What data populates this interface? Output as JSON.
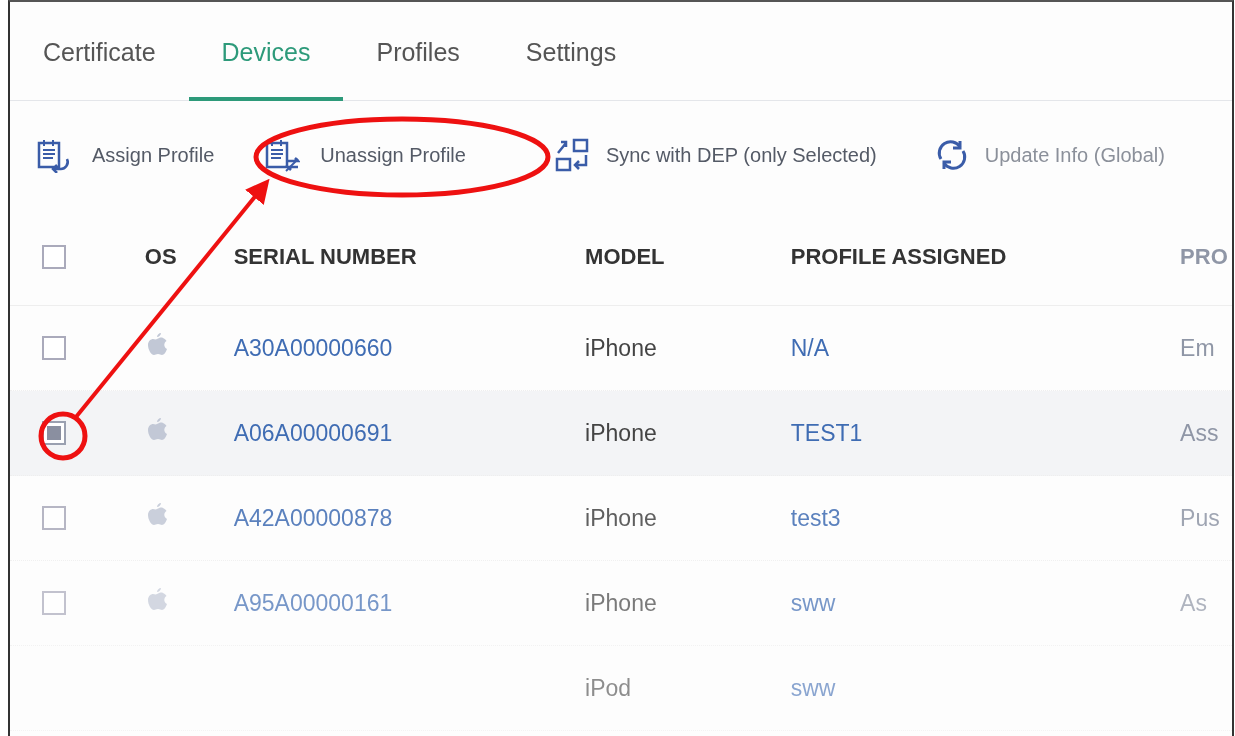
{
  "tabs": [
    {
      "label": "Certificate",
      "selected": false
    },
    {
      "label": "Devices",
      "selected": true
    },
    {
      "label": "Profiles",
      "selected": false
    },
    {
      "label": "Settings",
      "selected": false
    }
  ],
  "toolbar": [
    {
      "kind": "assign",
      "label": "Assign Profile"
    },
    {
      "kind": "unassign",
      "label": "Unassign Profile"
    },
    {
      "kind": "sync",
      "label": "Sync with DEP (only Selected)"
    },
    {
      "kind": "update",
      "label": "Update Info (Global)"
    }
  ],
  "table": {
    "select_all_checked": false,
    "columns": [
      "OS",
      "SERIAL NUMBER",
      "MODEL",
      "PROFILE ASSIGNED",
      "PRO"
    ],
    "rows": [
      {
        "checked": false,
        "serial": "A30A00000660",
        "model": "iPhone",
        "profile": "N/A",
        "column_6": "Em"
      },
      {
        "checked": true,
        "serial": "A06A00000691",
        "model": "iPhone",
        "profile": "TEST1",
        "column_6": "Ass"
      },
      {
        "checked": false,
        "serial": "A42A00000878",
        "model": "iPhone",
        "profile": "test3",
        "column_6": "Pus"
      },
      {
        "checked": false,
        "serial": "A95A00000161",
        "model": "iPhone",
        "profile": "sww",
        "column_6": "As"
      },
      {
        "model": "iPod",
        "profile": "sww"
      }
    ]
  }
}
